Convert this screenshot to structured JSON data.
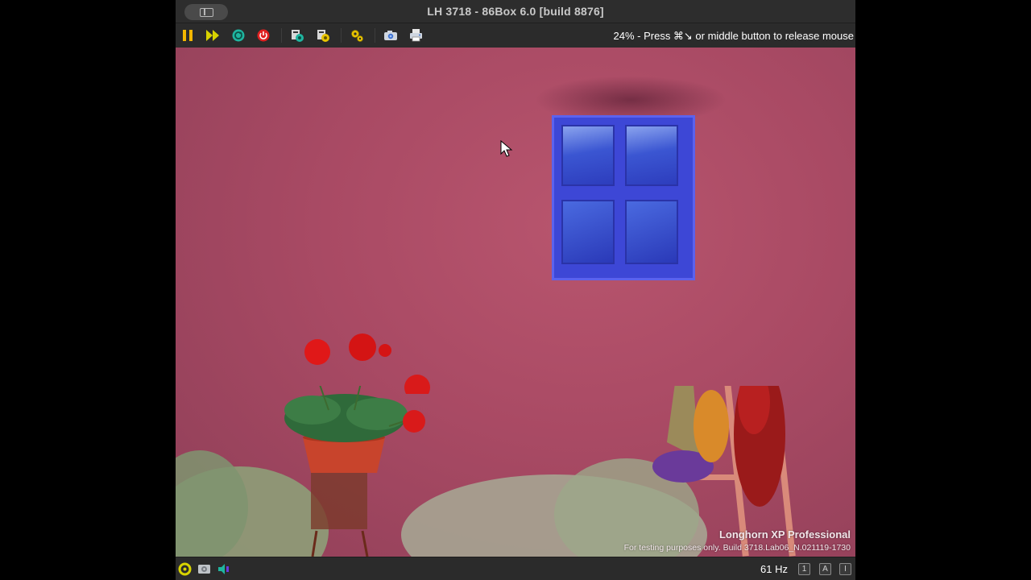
{
  "window": {
    "title": "LH 3718 - 86Box 6.0 [build 8876]"
  },
  "toolbar": {
    "buttons": [
      {
        "icon": "pause-icon",
        "label": "Pause"
      },
      {
        "icon": "fast-forward-icon",
        "label": "Ctrl+Alt+Del"
      },
      {
        "icon": "reset-icon",
        "label": "Hard reset"
      },
      {
        "icon": "power-icon",
        "label": "Power"
      },
      {
        "icon": "media-settings-icon",
        "label": "Media"
      },
      {
        "icon": "machine-settings-icon",
        "label": "Settings"
      },
      {
        "icon": "gear-icon",
        "label": "Settings"
      },
      {
        "icon": "camera-icon",
        "label": "Screenshot"
      },
      {
        "icon": "printer-icon",
        "label": "Copy"
      }
    ],
    "status_message": "24% - Press ⌘↘ or middle button to release mouse"
  },
  "guest_screen": {
    "watermark_title": "Longhorn XP Professional",
    "watermark_build": "For testing purposes only. Build 3718.Lab06_N.021119-1730"
  },
  "statusbar": {
    "refresh_rate": "61 Hz",
    "indicator_1": "1",
    "indicator_a": "A",
    "indicator_i": "I"
  },
  "colors": {
    "wall": "#a94a64",
    "window_frame": "#3d47d6",
    "toolbar_bg": "#2b2b2b",
    "pause_yellow": "#f2b600",
    "ff_yellow": "#d8d300",
    "reset_teal": "#1fb5a0",
    "power_red": "#e02020"
  }
}
